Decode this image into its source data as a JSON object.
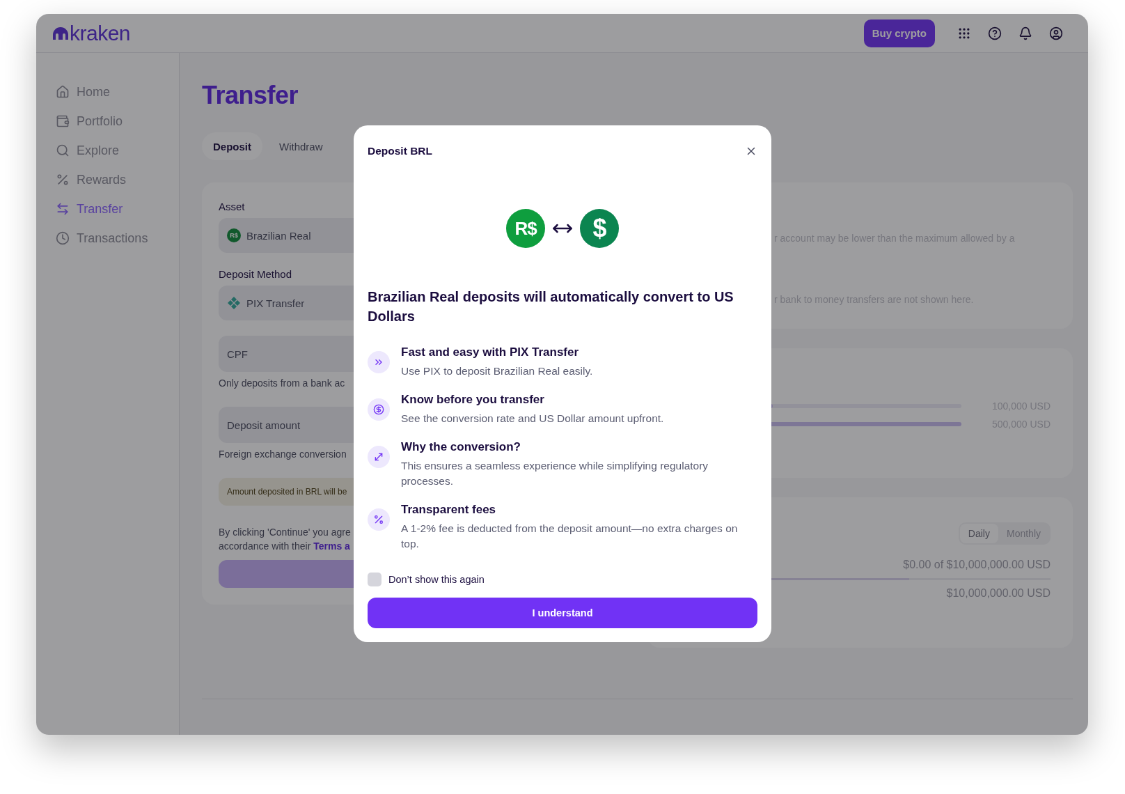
{
  "header": {
    "logo": "kraken",
    "buy_button": "Buy crypto"
  },
  "sidebar": {
    "items": [
      {
        "label": "Home",
        "selected": false
      },
      {
        "label": "Portfolio",
        "selected": false
      },
      {
        "label": "Explore",
        "selected": false
      },
      {
        "label": "Rewards",
        "selected": false
      },
      {
        "label": "Transfer",
        "selected": true
      },
      {
        "label": "Transactions",
        "selected": false
      }
    ]
  },
  "page": {
    "title": "Transfer",
    "tabs": [
      {
        "label": "Deposit",
        "selected": true
      },
      {
        "label": "Withdraw",
        "selected": false
      }
    ]
  },
  "form": {
    "asset_label": "Asset",
    "asset": "Brazilian Real",
    "asset_symbol": "R$",
    "method_label": "Deposit Method",
    "method": "PIX Transfer",
    "cpf_placeholder": "CPF",
    "cpf_hint": "Only deposits from a bank ac",
    "amount_placeholder": "Deposit amount",
    "amount_hint": "Foreign exchange conversion",
    "notice": "Amount deposited in BRL will be",
    "terms_line1": "By clicking 'Continue' you agre",
    "terms_line2": "accordance with their",
    "terms_link": "Terms a"
  },
  "info_card": {
    "lines": [
      "r account may be lower than the maximum allowed by a",
      "r bank to money transfers are not shown here."
    ]
  },
  "limits_card": {
    "rows": [
      {
        "level": 0.4,
        "reading": "100,000 USD"
      },
      {
        "level": 1,
        "reading": "500,000 USD"
      }
    ]
  },
  "usage_card": {
    "periods": [
      {
        "label": "Daily",
        "selected": true
      },
      {
        "label": "Monthly",
        "selected": false
      }
    ],
    "used": "$0.00 of $10,000,000.00 USD",
    "level": 0.65,
    "remaining": "$10,000,000.00 USD"
  },
  "modal": {
    "title": "Deposit BRL",
    "from_symbol": "R$",
    "to_symbol": "$",
    "headline": "Brazilian Real deposits will automatically convert to US Dollars",
    "features": [
      {
        "title": "Fast and easy with PIX Transfer",
        "text": "Use PIX to deposit Brazilian Real easily."
      },
      {
        "title": "Know before you transfer",
        "text": "See the conversion rate and US Dollar amount upfront."
      },
      {
        "title": "Why the conversion?",
        "text": "This ensures a seamless experience while simplifying regulatory processes."
      },
      {
        "title": "Transparent fees",
        "text": "A 1-2% fee is deducted from the deposit amount—no extra charges on top."
      }
    ],
    "checkbox": {
      "label": "Don’t show this again",
      "checked": false
    },
    "button": "I understand"
  }
}
